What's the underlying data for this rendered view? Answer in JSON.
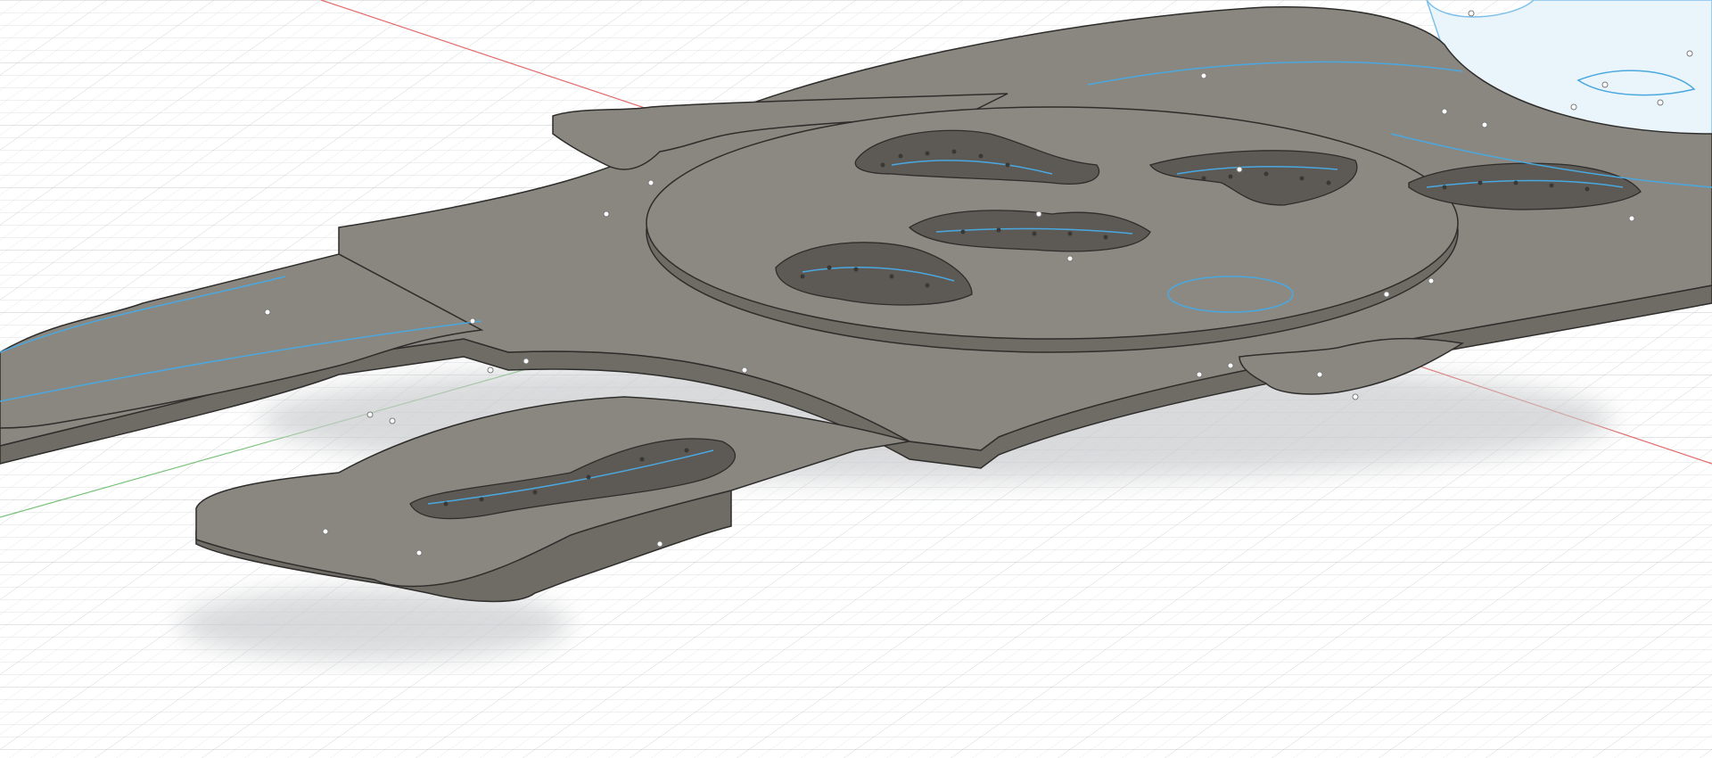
{
  "viewport": {
    "background": "#ffffff",
    "grid_color": "#d9dcdf",
    "grid_major_color": "#c4c8cc",
    "axis_x_color": "#e06a6a",
    "axis_y_color": "#7ac27a"
  },
  "model": {
    "body_fill": "#8a8780",
    "side_fill": "#6f6c66",
    "edge_color": "#2e2d2b",
    "sketch_color": "#4aa8e0",
    "pocket_fill": "#5d5a55",
    "shadow_color": "#c9cbcd",
    "point_color": "#ffffff"
  },
  "icons": {
    "sketch_profile": "sketch-profile-icon"
  }
}
